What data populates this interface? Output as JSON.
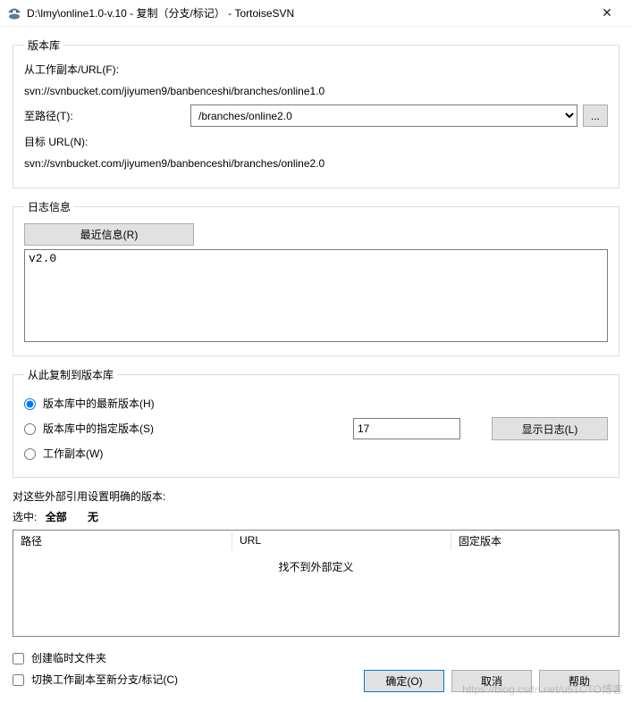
{
  "window": {
    "title": "D:\\lmy\\online1.0-v.10 - 复制（分支/标记） - TortoiseSVN",
    "close_glyph": "✕"
  },
  "repo": {
    "legend": "版本库",
    "from_label": "从工作副本/URL(F):",
    "from_url": "svn://svnbucket.com/jiyumen9/banbenceshi/branches/online1.0",
    "to_label": "至路径(T):",
    "to_path": "/branches/online2.0",
    "browse_label": "...",
    "target_label": "目标 URL(N):",
    "target_url": "svn://svnbucket.com/jiyumen9/banbenceshi/branches/online2.0"
  },
  "log": {
    "legend": "日志信息",
    "recent_btn": "最近信息(R)",
    "message": "v2.0"
  },
  "copy": {
    "legend": "从此复制到版本库",
    "opt_head": "版本库中的最新版本(H)",
    "opt_specific": "版本库中的指定版本(S)",
    "opt_wc": "工作副本(W)",
    "revision": "17",
    "showlog_btn": "显示日志(L)"
  },
  "externals": {
    "label": "对这些外部引用设置明确的版本:",
    "select_prefix": "选中:",
    "select_all": "全部",
    "select_none": "无",
    "col_path": "路径",
    "col_url": "URL",
    "col_rev": "固定版本",
    "empty_msg": "找不到外部定义"
  },
  "bottom": {
    "chk_intermediate": "创建临时文件夹",
    "chk_switch": "切换工作副本至新分支/标记(C)",
    "ok": "确定(O)",
    "cancel": "取消",
    "help": "帮助"
  },
  "watermark": "https://blog.csdn.net/u51CTO博客"
}
